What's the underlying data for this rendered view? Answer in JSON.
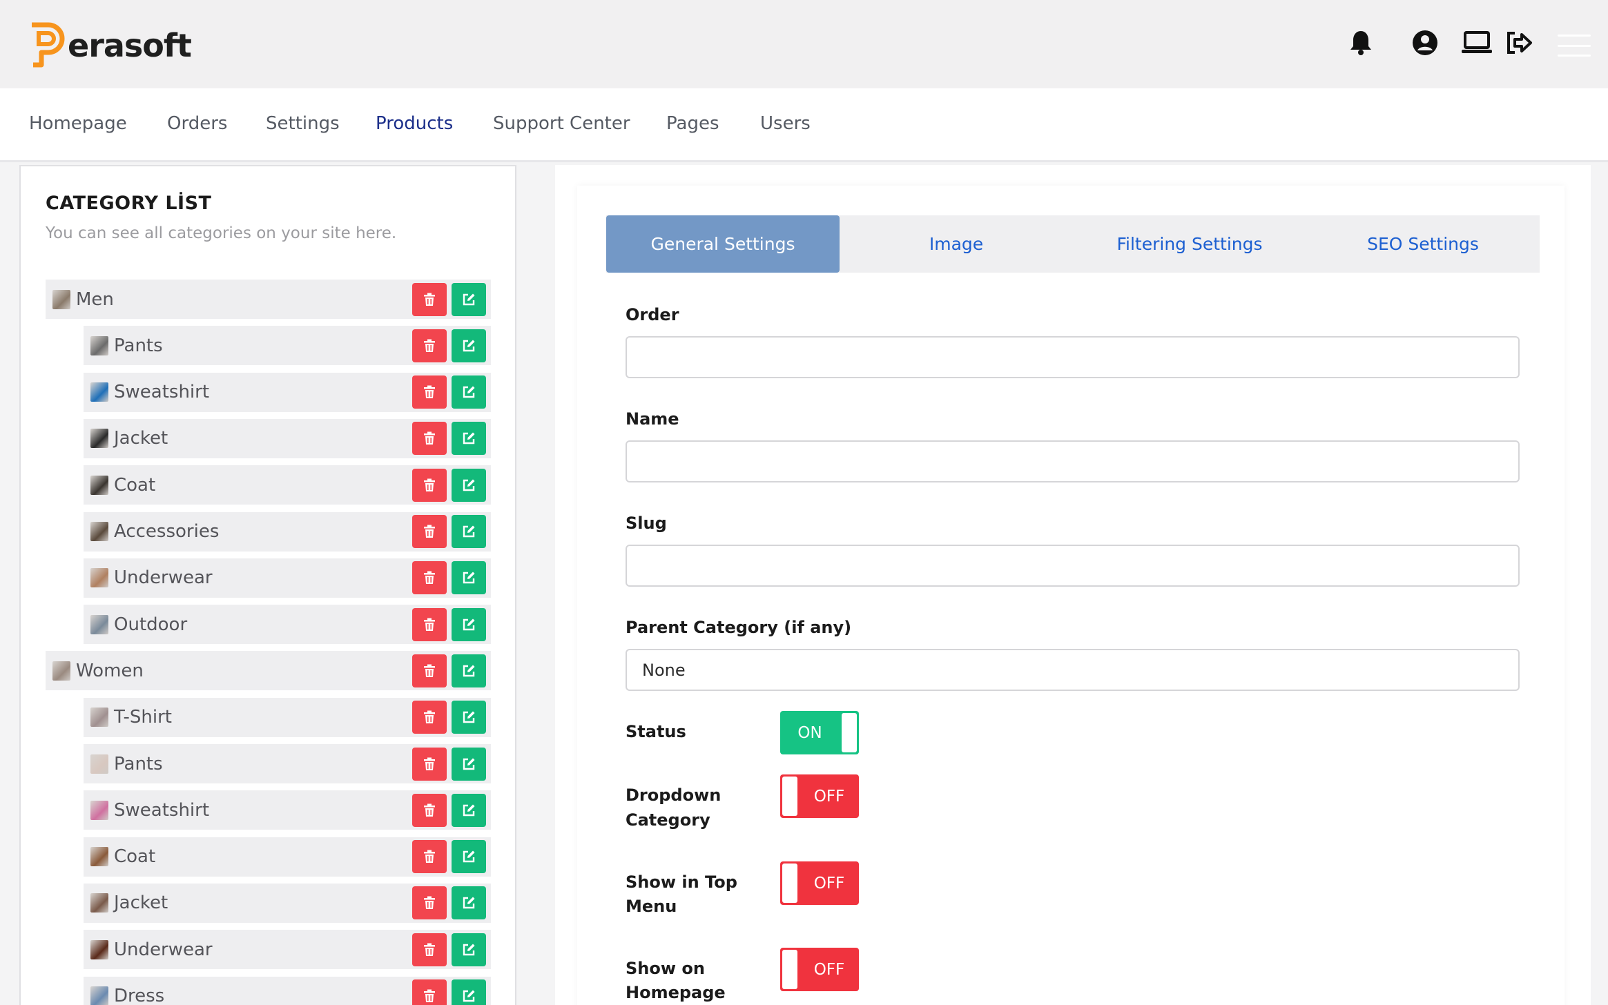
{
  "brand": {
    "name": "erasoft",
    "accent_color": "#f7941d"
  },
  "header_icons": [
    "bell-icon",
    "user-circle-icon",
    "laptop-icon",
    "sign-out-icon",
    "menu-icon"
  ],
  "nav": {
    "items": [
      {
        "label": "Homepage",
        "active": false
      },
      {
        "label": "Orders",
        "active": false
      },
      {
        "label": "Settings",
        "active": false
      },
      {
        "label": "Products",
        "active": true
      },
      {
        "label": "Support Center",
        "active": false
      },
      {
        "label": "Pages",
        "active": false
      },
      {
        "label": "Users",
        "active": false
      }
    ]
  },
  "category_list": {
    "title": "CATEGORY LİST",
    "subtitle": "You can see all categories on your site here.",
    "items": [
      {
        "label": "Men",
        "level": 0,
        "thumb": "#8a7a6a"
      },
      {
        "label": "Pants",
        "level": 1,
        "thumb": "#6b6b6b"
      },
      {
        "label": "Sweatshirt",
        "level": 1,
        "thumb": "#1f6fb8"
      },
      {
        "label": "Jacket",
        "level": 1,
        "thumb": "#2a2a2a"
      },
      {
        "label": "Coat",
        "level": 1,
        "thumb": "#3a3530"
      },
      {
        "label": "Accessories",
        "level": 1,
        "thumb": "#5a4a3c"
      },
      {
        "label": "Underwear",
        "level": 1,
        "thumb": "#b08060"
      },
      {
        "label": "Outdoor",
        "level": 1,
        "thumb": "#7a8a9a"
      },
      {
        "label": "Women",
        "level": 0,
        "thumb": "#9a8a80"
      },
      {
        "label": "T-Shirt",
        "level": 1,
        "thumb": "#a09090"
      },
      {
        "label": "Pants",
        "level": 1,
        "thumb": "#d8c8c0"
      },
      {
        "label": "Sweatshirt",
        "level": 1,
        "thumb": "#d070a0"
      },
      {
        "label": "Coat",
        "level": 1,
        "thumb": "#8a5a3a"
      },
      {
        "label": "Jacket",
        "level": 1,
        "thumb": "#7a5a4a"
      },
      {
        "label": "Underwear",
        "level": 1,
        "thumb": "#5a2a1a"
      },
      {
        "label": "Dress",
        "level": 1,
        "thumb": "#6a8ab0"
      }
    ],
    "delete_color": "#f2454e",
    "edit_color": "#13b97a"
  },
  "tabs": [
    {
      "label": "General Settings",
      "active": true
    },
    {
      "label": "Image",
      "active": false
    },
    {
      "label": "Filtering Settings",
      "active": false
    },
    {
      "label": "SEO Settings",
      "active": false
    }
  ],
  "form": {
    "order_label": "Order",
    "order_value": "",
    "name_label": "Name",
    "name_value": "",
    "slug_label": "Slug",
    "slug_value": "",
    "parent_label": "Parent Category (if any)",
    "parent_value": "None",
    "status_label": "Status",
    "status_value": "ON",
    "dropdown_label_1": "Dropdown",
    "dropdown_label_2": "Category",
    "dropdown_value": "OFF",
    "topmenu_label_1": "Show in Top",
    "topmenu_label_2": "Menu",
    "topmenu_value": "OFF",
    "homepage_label_1": "Show on",
    "homepage_label_2": "Homepage",
    "homepage_value": "OFF"
  }
}
